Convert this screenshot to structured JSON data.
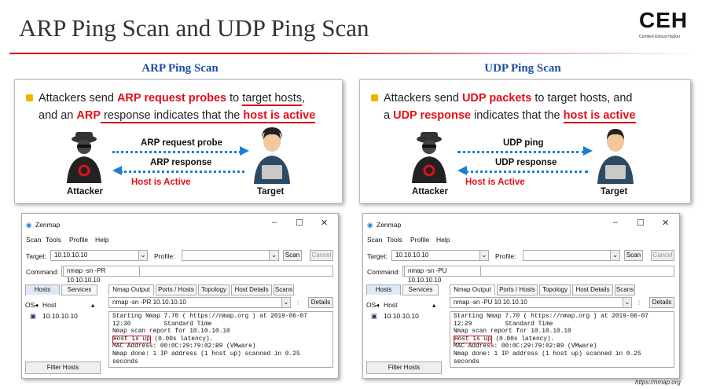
{
  "title": "ARP Ping Scan and UDP Ping Scan",
  "logo": {
    "letters": "CEH",
    "sub1": "Certified",
    "sub2": "Ethical Hacker"
  },
  "credit": "https://nmap.org",
  "arp": {
    "heading": "ARP Ping Scan",
    "b1": "Attackers send ",
    "b2": "ARP request probes",
    "b3": " to ",
    "b4": "target hosts",
    "b5": ",",
    "b6": "and an ",
    "b7": "ARP",
    "b8": " response",
    "b9": " indicates that the ",
    "b10": "host is active",
    "probe": "ARP request probe",
    "response": "ARP response",
    "active": "Host is Active",
    "attacker": "Attacker",
    "target": "Target"
  },
  "udp": {
    "heading": "UDP Ping Scan",
    "b1": "Attackers send ",
    "b2": "UDP packets",
    "b3": " to target hosts, and",
    "b4": "a ",
    "b5": "UDP response",
    "b6": " indicates that the ",
    "b7": "host is active",
    "probe": "UDP ping",
    "response": "UDP response",
    "active": "Host is Active",
    "attacker": "Attacker",
    "target": "Target"
  },
  "zenmap_left": {
    "app": "Zenmap",
    "menu": [
      "Scan",
      "Tools",
      "Profile",
      "Help"
    ],
    "target_label": "Target:",
    "target_value": "10.10.10.10",
    "profile_label": "Profile:",
    "scan_btn": "Scan",
    "cancel_btn": "Cancel",
    "command_label": "Command:",
    "command_value": "nmap -sn -PR 10.10.10.10",
    "hosts_btn": "Hosts",
    "services_btn": "Services",
    "tabs": [
      "Nmap Output",
      "Ports / Hosts",
      "Topology",
      "Host Details",
      "Scans"
    ],
    "os_header": "OS",
    "host_header": "Host",
    "host_item": "10.10.10.10",
    "output_select": "nmap -sn -PR 10.10.10.10",
    "details_btn": "Details",
    "filter_btn": "Filter Hosts",
    "line1": "Starting Nmap 7.70 ( https://nmap.org ) at 2019-06-07",
    "line2": "12:30         Standard Time",
    "line3": "Nmap scan report for 10.10.10.10",
    "line4a": "Host is up",
    "line4b": " (0.00s latency).",
    "line5": "MAC Address: 00:0C:29:79:02:B9 (VMware)",
    "line6": "Nmap done: 1 IP address (1 host up) scanned in 0.25",
    "line7": "seconds"
  },
  "zenmap_right": {
    "app": "Zenmap",
    "menu": [
      "Scan",
      "Tools",
      "Profile",
      "Help"
    ],
    "target_label": "Target:",
    "target_value": "10.10.10.10",
    "profile_label": "Profile:",
    "scan_btn": "Scan",
    "cancel_btn": "Cancel",
    "command_label": "Command:",
    "command_value": "nmap -sn -PU 10.10.10.10",
    "hosts_btn": "Hosts",
    "services_btn": "Services",
    "tabs": [
      "Nmap Output",
      "Ports / Hosts",
      "Topology",
      "Host Details",
      "Scans"
    ],
    "os_header": "OS",
    "host_header": "Host",
    "host_item": "10.10.10.10",
    "output_select": "nmap -sn -PU 10.10.10.10",
    "details_btn": "Details",
    "filter_btn": "Filter Hosts",
    "line1": "Starting Nmap 7.70 ( https://nmap.org ) at 2019-06-07",
    "line2": "12:29         Standard Time",
    "line3": "Nmap scan report for 10.10.10.10",
    "line4a": "Host is up",
    "line4b": " (0.00s latency).",
    "line5": "MAC Address: 00:0C:29:79:02:B9 (VMware)",
    "line6": "Nmap done: 1 IP address (1 host up) scanned in 0.25",
    "line7": "seconds"
  },
  "window_controls": {
    "min": "–",
    "max": "☐",
    "close": "✕"
  },
  "colors": {
    "accent_red": "#e0101a",
    "heading_blue": "#1f4fa3",
    "arrow_blue": "#1a7fd4",
    "bullet_yellow": "#f0b400"
  }
}
